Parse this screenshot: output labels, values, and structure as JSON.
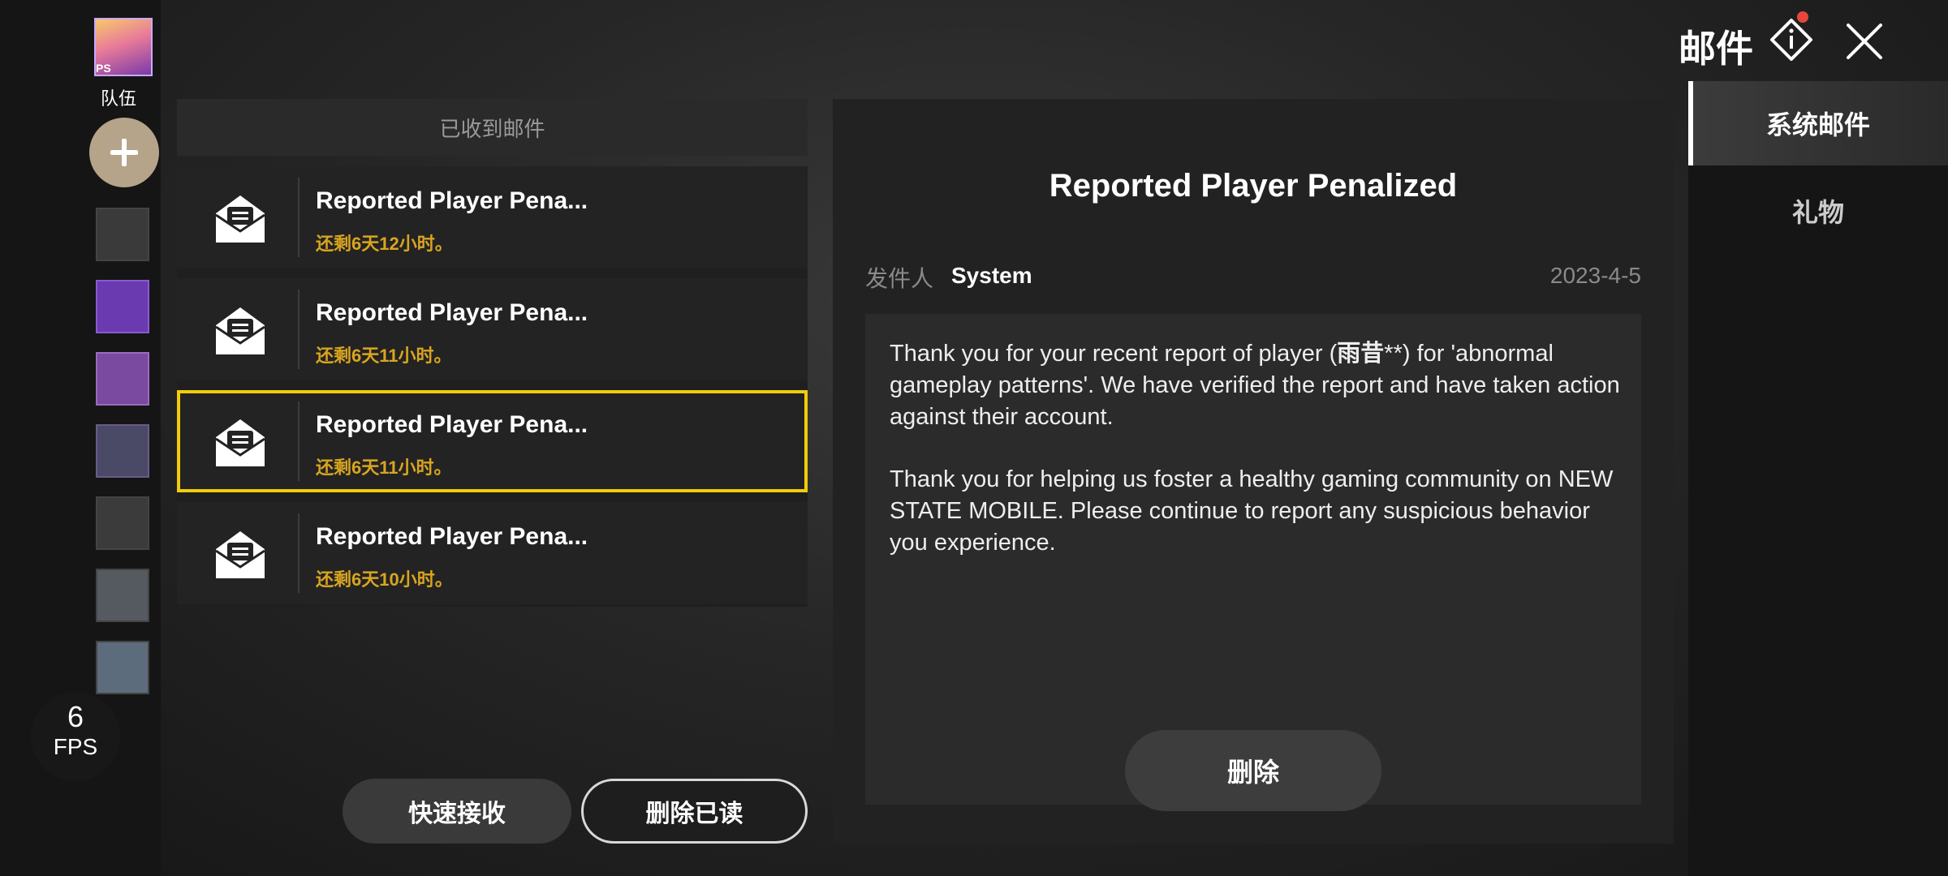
{
  "sidebar": {
    "avatar_tag": "PS",
    "team_label": "队伍",
    "friend_avatar_colors": [
      "#3a3a3a",
      "#6a3bb0",
      "#7a4aa0",
      "#4a4a66",
      "#3b3b3b",
      "#555a60",
      "#5d6c7d"
    ]
  },
  "fps": {
    "value": "6",
    "label": "FPS"
  },
  "header": {
    "title": "邮件",
    "notification_dot_color": "#e8463d"
  },
  "mail_list": {
    "header": "已收到邮件",
    "items": [
      {
        "subject": "Reported Player Pena...",
        "remaining": "还剩6天12小时。"
      },
      {
        "subject": "Reported Player Pena...",
        "remaining": "还剩6天11小时。"
      },
      {
        "subject": "Reported Player Pena...",
        "remaining": "还剩6天11小时。"
      },
      {
        "subject": "Reported Player Pena...",
        "remaining": "还剩6天10小时。"
      }
    ],
    "selected_index": 2,
    "quick_receive_label": "快速接收",
    "delete_read_label": "删除已读"
  },
  "detail": {
    "title": "Reported Player Penalized",
    "sender_label": "发件人",
    "sender": "System",
    "date": "2023-4-5",
    "body_p1_a": "Thank you for your recent report of player (",
    "body_p1_name": "雨昔",
    "body_p1_b": "**) for 'abnormal gameplay patterns'. We have verified the report and have taken action against their account.",
    "body_p2": "Thank you for helping us foster a healthy gaming community on NEW STATE MOBILE. Please continue to report any suspicious behavior you experience.",
    "delete_label": "删除"
  },
  "tabs": [
    {
      "label": "系统邮件",
      "active": true
    },
    {
      "label": "礼物",
      "active": false
    }
  ],
  "colors": {
    "accent_yellow": "#f2cc0c",
    "remaining_text": "#d9a520"
  }
}
